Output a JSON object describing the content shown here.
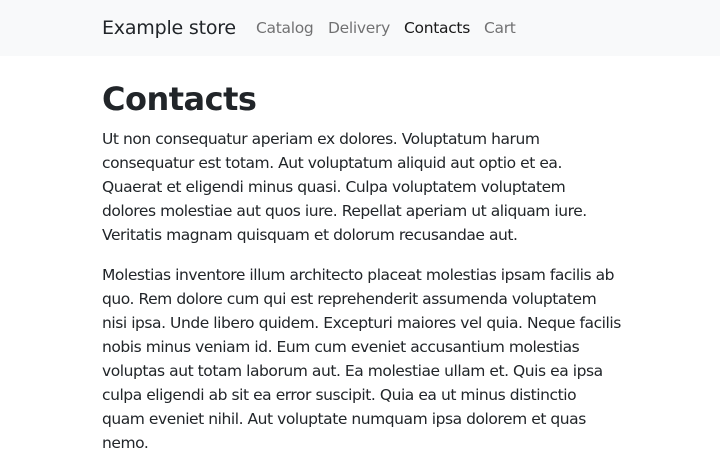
{
  "navbar": {
    "brand": "Example store",
    "items": [
      {
        "label": "Catalog",
        "active": false
      },
      {
        "label": "Delivery",
        "active": false
      },
      {
        "label": "Contacts",
        "active": true
      },
      {
        "label": "Cart",
        "active": false
      }
    ]
  },
  "main": {
    "title": "Contacts",
    "paragraphs": [
      "Ut non consequatur aperiam ex dolores. Voluptatum harum consequatur est totam. Aut voluptatum aliquid aut optio et ea. Quaerat et eligendi minus quasi. Culpa voluptatem voluptatem dolores molestiae aut quos iure. Repellat aperiam ut aliquam iure. Veritatis magnam quisquam et dolorum recusandae aut.",
      "Molestias inventore illum architecto placeat molestias ipsam facilis ab quo. Rem dolore cum qui est reprehenderit assumenda voluptatem nisi ipsa. Unde libero quidem. Excepturi maiores vel quia. Neque facilis nobis minus veniam id. Eum cum eveniet accusantium molestias voluptas aut totam laborum aut. Ea molestiae ullam et. Quis ea ipsa culpa eligendi ab sit ea error suscipit. Quia ea ut minus distinctio quam eveniet nihil. Aut voluptate numquam ipsa dolorem et quas nemo."
    ]
  },
  "colors": {
    "navbar_bg": "#f8f9fa",
    "text": "#212529",
    "nav_inactive": "#737373"
  }
}
